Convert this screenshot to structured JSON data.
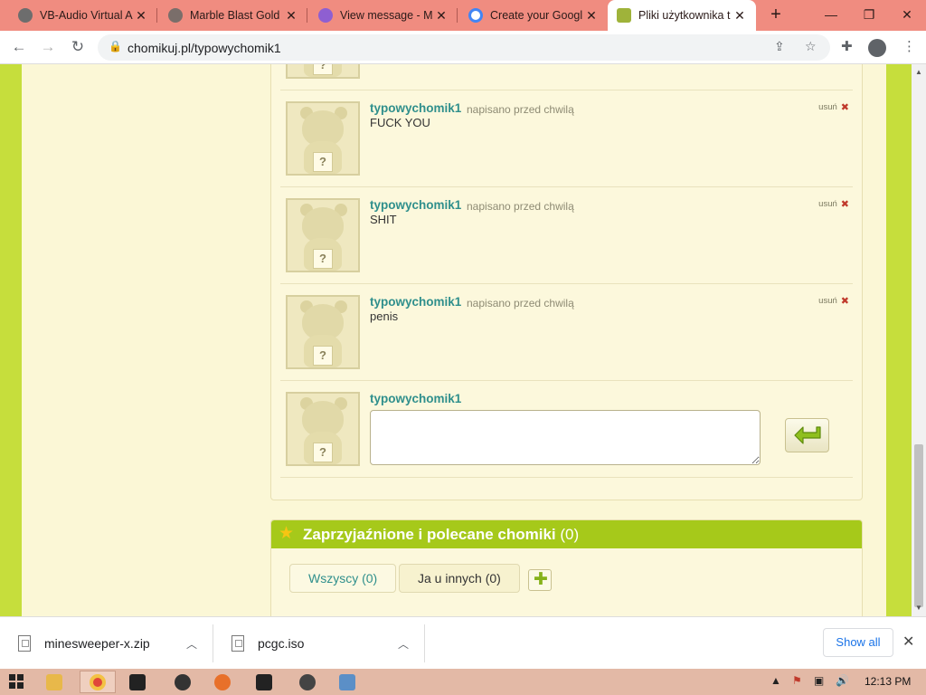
{
  "browser": {
    "tabs": [
      {
        "title": "VB-Audio Virtual A",
        "active": false
      },
      {
        "title": "Marble Blast Gold",
        "active": false
      },
      {
        "title": "View message - M",
        "active": false
      },
      {
        "title": "Create your Googl",
        "active": false
      },
      {
        "title": "Pliki użytkownika t",
        "active": true
      }
    ],
    "url": "chomikuj.pl/typowychomik1"
  },
  "comments": [
    {
      "user": "typowychomik1",
      "meta": "napisano przed chwilą",
      "text": "FUCK YOU",
      "delete_label": "usuń"
    },
    {
      "user": "typowychomik1",
      "meta": "napisano przed chwilą",
      "text": "SHIT",
      "delete_label": "usuń"
    },
    {
      "user": "typowychomik1",
      "meta": "napisano przed chwilą",
      "text": "penis",
      "delete_label": "usuń"
    }
  ],
  "reply": {
    "user": "typowychomik1",
    "value": "",
    "placeholder": ""
  },
  "hamster_mark": "?",
  "friends": {
    "title": "Zaprzyjaźnione i polecane chomiki",
    "count": "(0)",
    "tabs": [
      "Wszyscy (0)",
      "Ja u innych (0)"
    ]
  },
  "downloads": {
    "items": [
      {
        "name": "minesweeper-x.zip"
      },
      {
        "name": "pcgc.iso"
      }
    ],
    "show_all": "Show all"
  },
  "taskbar": {
    "time": "12:13 PM"
  },
  "colors": {
    "page_bg": "#c6de3c",
    "link": "#2f8f8c",
    "accent": "#a6c91a",
    "tab_strip": "#f08c80"
  }
}
